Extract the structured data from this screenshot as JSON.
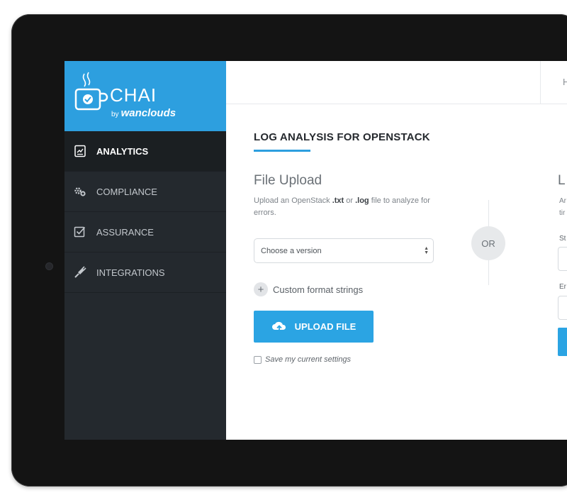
{
  "brand": {
    "name": "CHAI",
    "by": "by",
    "company": "wanclouds",
    "color": "#2d9fdf"
  },
  "sidebar": {
    "items": [
      {
        "label": "ANALYTICS",
        "icon": "analytics-icon",
        "active": true
      },
      {
        "label": "COMPLIANCE",
        "icon": "gears-icon",
        "active": false
      },
      {
        "label": "ASSURANCE",
        "icon": "checkbox-icon",
        "active": false
      },
      {
        "label": "INTEGRATIONS",
        "icon": "plug-icon",
        "active": false
      }
    ]
  },
  "topbar": {
    "clipped_letter": "H"
  },
  "page": {
    "title": "LOG ANALYSIS FOR OPENSTACK"
  },
  "upload": {
    "title": "File Upload",
    "desc_prefix": "Upload an OpenStack ",
    "ext_txt": ".txt",
    "desc_or": " or ",
    "ext_log": ".log",
    "desc_suffix": " file to analyze for errors.",
    "select_value": "Choose a version",
    "custom_label": "Custom format strings",
    "upload_button": "UPLOAD FILE",
    "save_label": "Save my current settings"
  },
  "divider": {
    "or_label": "OR"
  },
  "right_column": {
    "title": "L",
    "line1": "Ar",
    "line2": "tir",
    "label1": "St",
    "label2": "Er"
  },
  "colors": {
    "accent": "#2d9fdf",
    "button": "#2ba4e3",
    "sidebar_bg": "#24292e"
  }
}
